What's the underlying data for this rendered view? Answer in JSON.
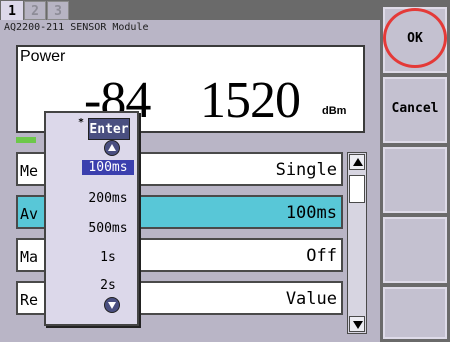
{
  "tabs": [
    {
      "label": "1",
      "active": true
    },
    {
      "label": "2",
      "active": false
    },
    {
      "label": "3",
      "active": false
    }
  ],
  "module_title": "AQ2200-211 SENSOR Module",
  "power": {
    "label": "Power",
    "value_main": "-84",
    "value_extra": "1520",
    "unit": "dBm"
  },
  "rows": [
    {
      "label": "Me",
      "value": "Single",
      "selected": false
    },
    {
      "label": "Av",
      "value": "100ms",
      "selected": true
    },
    {
      "label": "Ma",
      "value": "Off",
      "selected": false
    },
    {
      "label": "Re",
      "value": "Value",
      "selected": false
    }
  ],
  "softkeys": {
    "ok_label": "OK",
    "cancel_label": "Cancel"
  },
  "popup": {
    "enter_label": "Enter",
    "enter_mark": "*",
    "options": [
      "100ms",
      "200ms",
      "500ms",
      "1s",
      "2s"
    ],
    "selected_index": 0
  },
  "colors": {
    "selected_row": "#58c7d7",
    "popup_highlight": "#3b3fae",
    "ok_circle": "#e43a38",
    "level_bar": "#6dc84a"
  }
}
